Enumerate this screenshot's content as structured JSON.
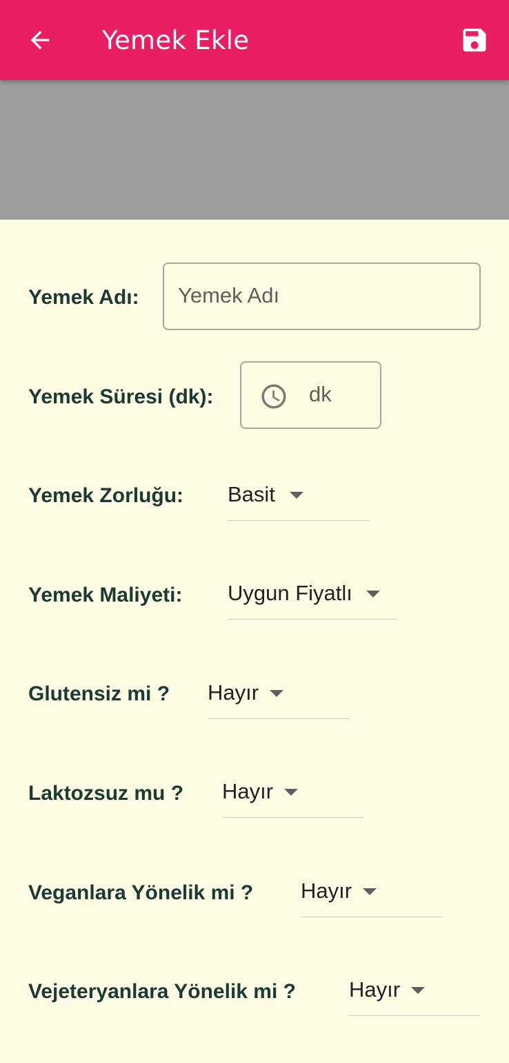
{
  "appbar": {
    "title": "Yemek Ekle",
    "back_icon": "arrow-back-icon",
    "save_icon": "save-icon",
    "color": "#e91e63"
  },
  "form": {
    "name": {
      "label": "Yemek Adı:",
      "placeholder": "Yemek Adı"
    },
    "duration": {
      "label": "Yemek Süresi (dk):",
      "placeholder": "dk",
      "icon": "clock-icon"
    },
    "difficulty": {
      "label": "Yemek Zorluğu:",
      "value": "Basit"
    },
    "cost": {
      "label": "Yemek Maliyeti:",
      "value": "Uygun Fiyatlı"
    },
    "gluten_free": {
      "label": "Glutensiz mi ?",
      "value": "Hayır"
    },
    "lactose_free": {
      "label": "Laktozsuz mu ?",
      "value": "Hayır"
    },
    "vegan": {
      "label": "Veganlara Yönelik mi ?",
      "value": "Hayır"
    },
    "vegetarian": {
      "label": "Vejeteryanlara Yönelik mi ?",
      "value": "Hayır"
    }
  }
}
